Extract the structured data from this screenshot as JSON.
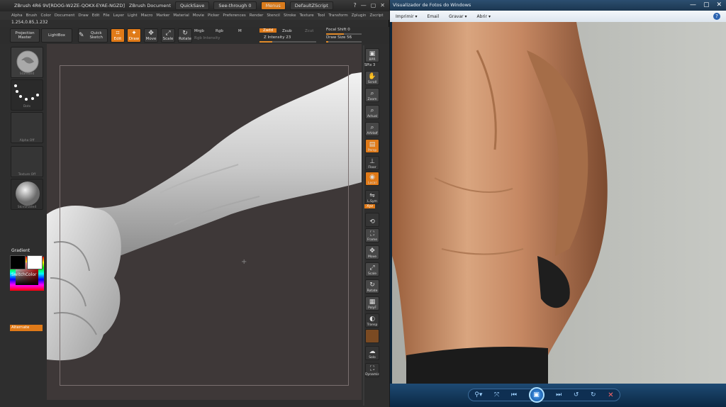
{
  "zbrush": {
    "title_items": [
      "ZBrush 4R6 9V[RDOG-W2ZE-QOKX-EYAE-NGZD]",
      "ZBrush Document"
    ],
    "quicksave": "QuickSave",
    "see_through": "See-through 0",
    "menus_btn": "Menus",
    "default_script": "DefaultZScript",
    "window_controls": [
      "?",
      "—",
      "▢",
      "✕"
    ],
    "menu_items": [
      "Alpha",
      "Brush",
      "Color",
      "Document",
      "Draw",
      "Edit",
      "File",
      "Layer",
      "Light",
      "Macro",
      "Marker",
      "Material",
      "Movie",
      "Picker",
      "Preferences",
      "Render",
      "Stencil",
      "Stroke",
      "Texture",
      "Tool",
      "Transform",
      "Zplugin",
      "Zscript"
    ],
    "coords": "1.254,0.85,1.232",
    "toolbar": {
      "projection_master": "Projection Master",
      "lightbox": "LightBox",
      "quick_sketch": "Quick Sketch",
      "edit": "Edit",
      "draw": "Draw",
      "move": "Move",
      "scale": "Scale",
      "rotate": "Rotate",
      "mrgb": "Mrgb",
      "rgb": "Rgb",
      "m": "M",
      "rgb_intensity": "Rgb Intensity",
      "zadd": "Zadd",
      "zsub": "Zsub",
      "zcut": "Zcut",
      "z_intensity": "Z Intensity 23",
      "focal_shift": "Focal Shift 0",
      "draw_size": "Draw Size 56",
      "z_intensity_value": 0.23,
      "focal_shift_value": 0.5,
      "draw_size_value": 0.06
    },
    "left_tray": {
      "thumb_caps": [
        "Standard",
        "Dots",
        "Alpha Off",
        "Texture Off",
        "SkinShade4"
      ],
      "gradient": "Gradient",
      "switch_color": "SwitchColor",
      "alternate": "Alternate"
    },
    "right_tray": {
      "bpr": "BPR",
      "spix": "SPix 3",
      "buttons": [
        "Scroll",
        "Zoom",
        "Actual",
        "AAHalf",
        "Persp",
        "Floor",
        "Local",
        "L.Sym",
        "Xyz",
        "Frame",
        "Move",
        "Scale",
        "Rotate",
        "PolyF",
        "Transp",
        "Solo",
        "Dynamic"
      ]
    }
  },
  "viewer": {
    "title": "Visualizador de Fotos do Windows",
    "window_controls": [
      "—",
      "▢",
      "✕"
    ],
    "menu": [
      "Imprimir ▾",
      "Email",
      "Gravar ▾",
      "Abrir ▾"
    ],
    "help": "?",
    "dock_icons": [
      "zoom-icon",
      "fit-icon",
      "previous-icon",
      "slideshow-icon",
      "next-icon",
      "rotate-ccw-icon",
      "rotate-cw-icon",
      "delete-icon"
    ]
  }
}
